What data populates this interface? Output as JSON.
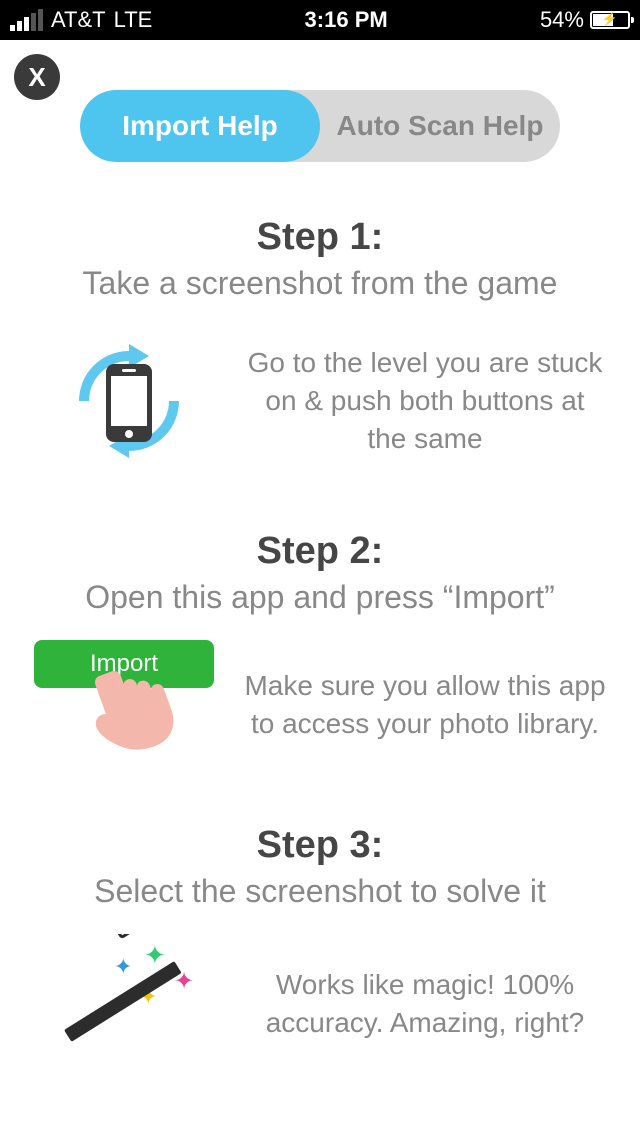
{
  "status_bar": {
    "carrier": "AT&T",
    "network": "LTE",
    "time": "3:16 PM",
    "battery_pct": "54%"
  },
  "close_label": "X",
  "tabs": {
    "import": "Import Help",
    "autoscan": "Auto Scan Help"
  },
  "steps": [
    {
      "label": "Step 1:",
      "title": "Take a screenshot from the game",
      "desc": "Go to the level you are stuck on & push both buttons at the same"
    },
    {
      "label": "Step 2:",
      "title": "Open this app and press “Import”",
      "button": "Import",
      "desc": "Make sure you allow this app to access your photo library."
    },
    {
      "label": "Step 3:",
      "title": "Select the screenshot to solve it",
      "desc": "Works like magic! 100% accuracy. Amazing, right?"
    }
  ]
}
